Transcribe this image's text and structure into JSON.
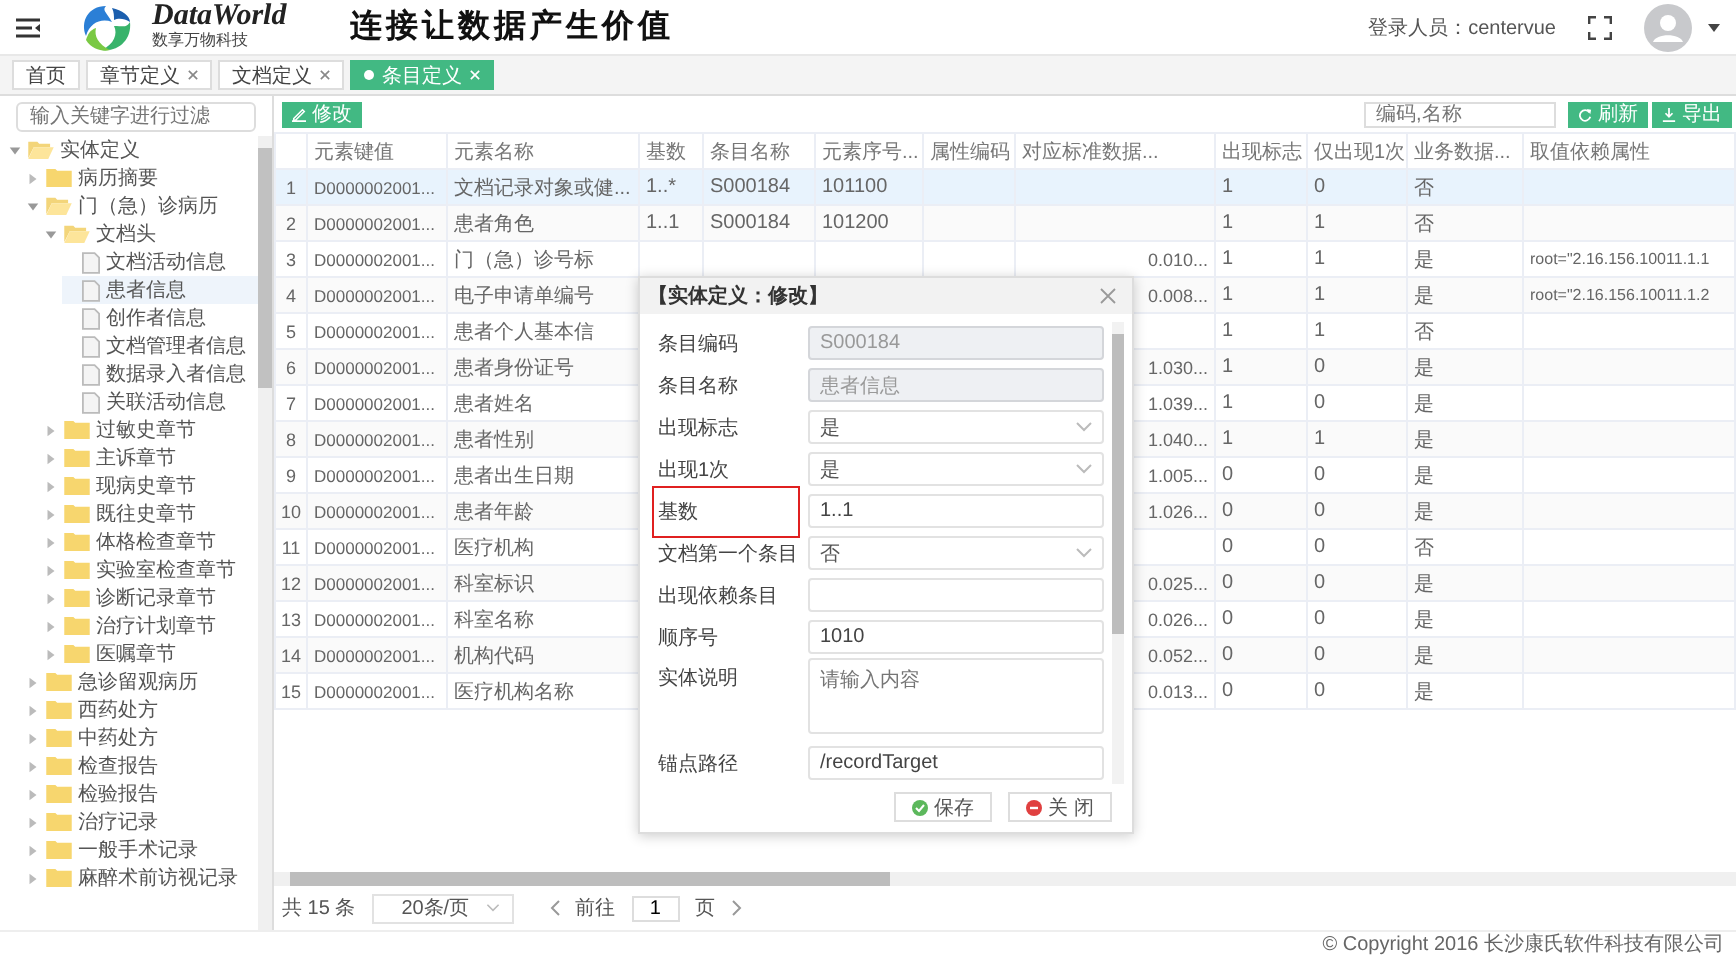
{
  "header": {
    "logo_name": "DataWorld",
    "logo_tagline": "数享万物科技",
    "slogan": "连接让数据产生价值",
    "user_label": "登录人员：centervue"
  },
  "tabs": [
    {
      "label": "首页",
      "closable": false,
      "selected": false
    },
    {
      "label": "章节定义",
      "closable": true,
      "selected": false
    },
    {
      "label": "文档定义",
      "closable": true,
      "selected": false
    },
    {
      "label": "条目定义",
      "closable": true,
      "selected": true
    }
  ],
  "sidebar": {
    "filter_placeholder": "输入关键字进行过滤",
    "tree": [
      {
        "label": "实体定义",
        "kind": "folder",
        "expanded": true,
        "selected": false,
        "children": [
          {
            "label": "病历摘要",
            "kind": "folder",
            "expanded": false,
            "selected": false
          },
          {
            "label": "门（急）诊病历",
            "kind": "folder",
            "expanded": true,
            "selected": false,
            "children": [
              {
                "label": "文档头",
                "kind": "folder",
                "expanded": true,
                "selected": false,
                "children": [
                  {
                    "label": "文档活动信息",
                    "kind": "file",
                    "selected": false
                  },
                  {
                    "label": "患者信息",
                    "kind": "file",
                    "selected": true
                  },
                  {
                    "label": "创作者信息",
                    "kind": "file",
                    "selected": false
                  },
                  {
                    "label": "文档管理者信息",
                    "kind": "file",
                    "selected": false
                  },
                  {
                    "label": "数据录入者信息",
                    "kind": "file",
                    "selected": false
                  },
                  {
                    "label": "关联活动信息",
                    "kind": "file",
                    "selected": false
                  }
                ]
              },
              {
                "label": "过敏史章节",
                "kind": "folder",
                "expanded": false,
                "selected": false
              },
              {
                "label": "主诉章节",
                "kind": "folder",
                "expanded": false,
                "selected": false
              },
              {
                "label": "现病史章节",
                "kind": "folder",
                "expanded": false,
                "selected": false
              },
              {
                "label": "既往史章节",
                "kind": "folder",
                "expanded": false,
                "selected": false
              },
              {
                "label": "体格检查章节",
                "kind": "folder",
                "expanded": false,
                "selected": false
              },
              {
                "label": "实验室检查章节",
                "kind": "folder",
                "expanded": false,
                "selected": false
              },
              {
                "label": "诊断记录章节",
                "kind": "folder",
                "expanded": false,
                "selected": false
              },
              {
                "label": "治疗计划章节",
                "kind": "folder",
                "expanded": false,
                "selected": false
              },
              {
                "label": "医嘱章节",
                "kind": "folder",
                "expanded": false,
                "selected": false
              }
            ]
          },
          {
            "label": "急诊留观病历",
            "kind": "folder",
            "expanded": false,
            "selected": false
          },
          {
            "label": "西药处方",
            "kind": "folder",
            "expanded": false,
            "selected": false
          },
          {
            "label": "中药处方",
            "kind": "folder",
            "expanded": false,
            "selected": false
          },
          {
            "label": "检查报告",
            "kind": "folder",
            "expanded": false,
            "selected": false
          },
          {
            "label": "检验报告",
            "kind": "folder",
            "expanded": false,
            "selected": false
          },
          {
            "label": "治疗记录",
            "kind": "folder",
            "expanded": false,
            "selected": false
          },
          {
            "label": "一般手术记录",
            "kind": "folder",
            "expanded": false,
            "selected": false
          },
          {
            "label": "麻醉术前访视记录",
            "kind": "folder",
            "expanded": false,
            "selected": false
          }
        ]
      }
    ]
  },
  "toolbar": {
    "edit_button": "修改",
    "search_placeholder": "编码,名称",
    "refresh_button": "刷新",
    "export_button": "导出"
  },
  "table": {
    "columns": [
      "",
      "元素键值",
      "元素名称",
      "基数",
      "条目名称",
      "元素序号...",
      "属性编码",
      "对应标准数据...",
      "出现标志",
      "仅出现1次",
      "业务数据...",
      "取值依赖属性"
    ],
    "rows": [
      {
        "selected": true,
        "cells": [
          "1",
          "D0000002001...",
          "文档记录对象或健...",
          "1..*",
          "S000184",
          "101100",
          "",
          "",
          "1",
          "0",
          "否",
          ""
        ]
      },
      {
        "selected": false,
        "cells": [
          "2",
          "D0000002001...",
          "患者角色",
          "1..1",
          "S000184",
          "101200",
          "",
          "",
          "1",
          "1",
          "否",
          ""
        ]
      },
      {
        "selected": false,
        "cells": [
          "3",
          "D0000002001...",
          "门（急）诊号标",
          "",
          "",
          "",
          "",
          "0.010...",
          "1",
          "1",
          "是",
          "root=\"2.16.156.10011.1.1"
        ]
      },
      {
        "selected": false,
        "cells": [
          "4",
          "D0000002001...",
          "电子申请单编号",
          "",
          "",
          "",
          "",
          "0.008...",
          "1",
          "1",
          "是",
          "root=\"2.16.156.10011.1.2"
        ]
      },
      {
        "selected": false,
        "cells": [
          "5",
          "D0000002001...",
          "患者个人基本信",
          "",
          "",
          "",
          "",
          "",
          "1",
          "1",
          "否",
          ""
        ]
      },
      {
        "selected": false,
        "cells": [
          "6",
          "D0000002001...",
          "患者身份证号",
          "",
          "",
          "",
          "",
          "1.030...",
          "1",
          "0",
          "是",
          ""
        ]
      },
      {
        "selected": false,
        "cells": [
          "7",
          "D0000002001...",
          "患者姓名",
          "",
          "",
          "",
          "",
          "1.039...",
          "1",
          "0",
          "是",
          ""
        ]
      },
      {
        "selected": false,
        "cells": [
          "8",
          "D0000002001...",
          "患者性别",
          "",
          "",
          "",
          "",
          "1.040...",
          "1",
          "1",
          "是",
          ""
        ]
      },
      {
        "selected": false,
        "cells": [
          "9",
          "D0000002001...",
          "患者出生日期",
          "",
          "",
          "",
          "",
          "1.005...",
          "0",
          "0",
          "是",
          ""
        ]
      },
      {
        "selected": false,
        "cells": [
          "10",
          "D0000002001...",
          "患者年龄",
          "",
          "",
          "",
          "",
          "1.026...",
          "0",
          "0",
          "是",
          ""
        ]
      },
      {
        "selected": false,
        "cells": [
          "11",
          "D0000002001...",
          "医疗机构",
          "",
          "",
          "",
          "",
          "",
          "0",
          "0",
          "否",
          ""
        ]
      },
      {
        "selected": false,
        "cells": [
          "12",
          "D0000002001...",
          "科室标识",
          "",
          "",
          "",
          "",
          "0.025...",
          "0",
          "0",
          "是",
          ""
        ]
      },
      {
        "selected": false,
        "cells": [
          "13",
          "D0000002001...",
          "科室名称",
          "",
          "",
          "",
          "",
          "0.026...",
          "0",
          "0",
          "是",
          ""
        ]
      },
      {
        "selected": false,
        "cells": [
          "14",
          "D0000002001...",
          "机构代码",
          "",
          "",
          "",
          "",
          "0.052...",
          "0",
          "0",
          "是",
          ""
        ]
      },
      {
        "selected": false,
        "cells": [
          "15",
          "D0000002001...",
          "医疗机构名称",
          "",
          "",
          "",
          "",
          "0.013...",
          "0",
          "0",
          "是",
          ""
        ]
      }
    ]
  },
  "modal": {
    "title": "【实体定义：修改】",
    "fields": [
      {
        "kind": "text",
        "label": "条目编码",
        "value": "S000184",
        "disabled": true,
        "highlighted": false
      },
      {
        "kind": "text",
        "label": "条目名称",
        "value": "患者信息",
        "disabled": true,
        "highlighted": false
      },
      {
        "kind": "select",
        "label": "出现标志",
        "value": "是",
        "disabled": false,
        "highlighted": false
      },
      {
        "kind": "select",
        "label": "出现1次",
        "value": "是",
        "disabled": false,
        "highlighted": false
      },
      {
        "kind": "text",
        "label": "基数",
        "value": "1..1",
        "disabled": false,
        "highlighted": true
      },
      {
        "kind": "select",
        "label": "文档第一个条目",
        "value": "否",
        "disabled": false,
        "highlighted": false
      },
      {
        "kind": "text",
        "label": "出现依赖条目",
        "disabled": false,
        "highlighted": false
      },
      {
        "kind": "text",
        "label": "顺序号",
        "value": "1010",
        "disabled": false,
        "highlighted": false
      },
      {
        "kind": "textarea",
        "label": "实体说明",
        "placeholder": "请输入内容",
        "disabled": false,
        "highlighted": false
      },
      {
        "kind": "text",
        "label": "锚点路径",
        "value": "/recordTarget",
        "disabled": false,
        "highlighted": false
      }
    ],
    "buttons": [
      {
        "kind": "save",
        "label": "保存"
      },
      {
        "kind": "close",
        "label": "关 闭"
      }
    ]
  },
  "pagination": {
    "total": "共 15 条",
    "page_size": "20条/页",
    "goto_label": "前往",
    "page": "1",
    "page_unit": "页"
  },
  "footer": "© Copyright 2016 长沙康氏软件科技有限公司"
}
